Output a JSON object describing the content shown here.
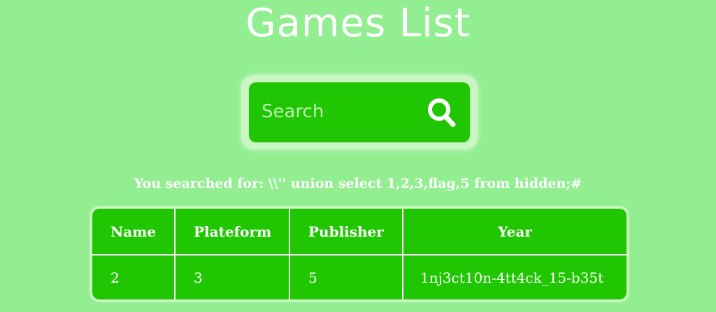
{
  "page": {
    "title": "Games List"
  },
  "search": {
    "placeholder": "Search",
    "value": "",
    "button_icon": "search-icon"
  },
  "result": {
    "searched_text": "You searched for: \\\\'' union select 1,2,3,flag,5 from hidden;#"
  },
  "table": {
    "headers": [
      "Name",
      "Plateform",
      "Publisher",
      "Year"
    ],
    "rows": [
      [
        "2",
        "3",
        "5",
        "1nj3ct10n-4tt4ck_15-b35t"
      ]
    ]
  },
  "colors": {
    "background": "#93ee91",
    "accent": "#21c603",
    "text": "#ffffff"
  }
}
